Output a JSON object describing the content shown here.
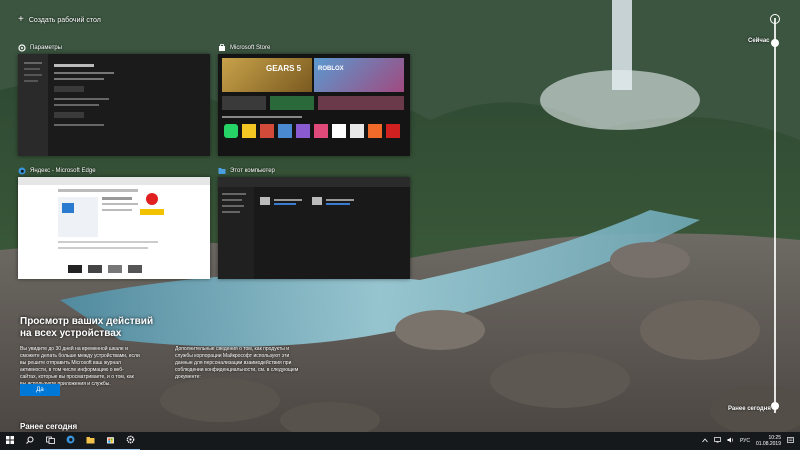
{
  "new_desktop_label": "Создать рабочий стол",
  "windows": [
    {
      "title": "Параметры",
      "icon": "gear-icon"
    },
    {
      "title": "Microsoft Store",
      "icon": "store-icon",
      "hero_text": "GEARS 5",
      "hero_text2": "ROBLOX"
    },
    {
      "title": "Яндекс - Microsoft Edge",
      "icon": "edge-icon"
    },
    {
      "title": "Этот компьютер",
      "icon": "folder-icon"
    }
  ],
  "timeline": {
    "now_label": "Сейчас",
    "earlier_label": "Ранее сегодня"
  },
  "promo": {
    "title": "Просмотр ваших действий на всех устройствах",
    "text1": "Вы увидите до 30 дней на временной шкале и сможете делать больше между устройствами, если вы решите отправить Microsoft ваш журнал активности, в том числе информацию о веб-сайтах, которые вы просматриваете, и о том, как вы используете приложения и службы.",
    "text2": "Дополнительные сведения о том, как продукты и службы корпорации Майкрософт используют эти данные для персонализации взаимодействия при соблюдении конфиденциальности, см. в следующем документе:",
    "yes_button": "Да"
  },
  "section_earlier": "Ранее сегодня",
  "taskbar": {
    "items": [
      "start-icon",
      "search-icon",
      "task-view-icon",
      "edge-icon",
      "explorer-icon",
      "store-icon",
      "settings-icon"
    ],
    "lang": "РУС",
    "time": "10:25",
    "date": "01.08.2019"
  },
  "colors": {
    "accent": "#0078d7",
    "taskbar": "#16191c"
  }
}
